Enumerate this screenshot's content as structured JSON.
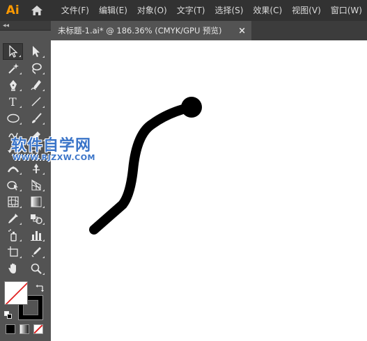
{
  "app": {
    "logo": "Ai"
  },
  "menu": {
    "items": [
      "文件(F)",
      "编辑(E)",
      "对象(O)",
      "文字(T)",
      "选择(S)",
      "效果(C)",
      "视图(V)",
      "窗口(W)"
    ]
  },
  "tools_panel": {
    "collapse_label": "◂◂",
    "tools": [
      [
        "selection-tool",
        "direct-selection-tool"
      ],
      [
        "magic-wand-tool",
        "lasso-tool"
      ],
      [
        "pen-tool",
        "curvature-tool"
      ],
      [
        "type-tool",
        "line-segment-tool"
      ],
      [
        "ellipse-tool",
        "paintbrush-tool"
      ],
      [
        "shaper-tool",
        "eraser-tool"
      ],
      [
        "rotate-tool",
        "scale-tool"
      ],
      [
        "width-tool",
        "puppet-warp-tool"
      ],
      [
        "shape-builder-tool",
        "perspective-grid-tool"
      ],
      [
        "mesh-tool",
        "gradient-tool"
      ],
      [
        "eyedropper-tool",
        "blend-tool"
      ],
      [
        "symbol-sprayer-tool",
        "column-graph-tool"
      ],
      [
        "artboard-tool",
        "slice-tool"
      ],
      [
        "hand-tool",
        "zoom-tool"
      ]
    ]
  },
  "watermark": {
    "title": "软件自学网",
    "url": "WWW.RJZXW.COM"
  },
  "document": {
    "tab_title": "未标题-1.ai* @ 186.36% (CMYK/GPU 预览)",
    "close_label": "×"
  },
  "colors": {
    "menubar_bg": "#323232",
    "panel_bg": "#535353",
    "logo": "#ff9a00",
    "stroke_path": "#000000",
    "canvas": "#ffffff",
    "watermark": "#3a74c8"
  }
}
